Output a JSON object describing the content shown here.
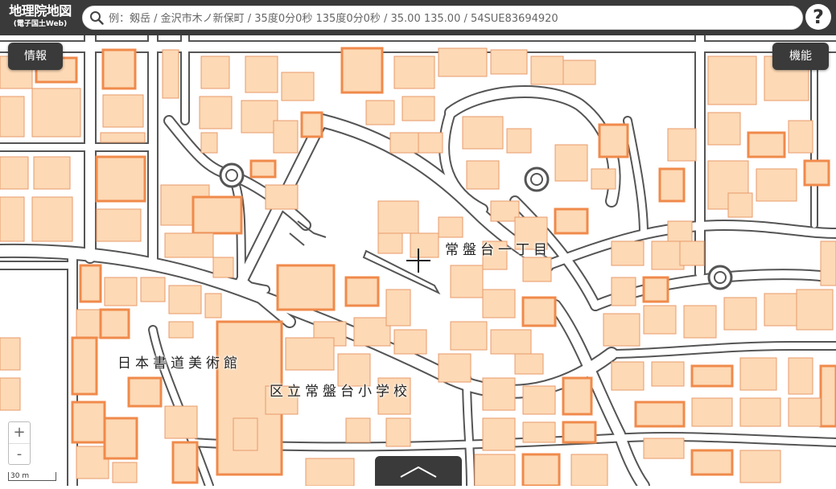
{
  "header": {
    "logo_main": "地理院地図",
    "logo_sub": "(電子国土Web)",
    "search_placeholder": "例：剱岳 / 金沢市木ノ新保町 / 35度0分0秒 135度0分0秒 / 35.00 135.00 / 54SUE83694920",
    "help_label": "?"
  },
  "buttons": {
    "info": "情報",
    "functions": "機能"
  },
  "map": {
    "labels": [
      {
        "id": "lbl-1",
        "text": "常盤台一丁目"
      },
      {
        "id": "lbl-2",
        "text": "日本書道美術館"
      },
      {
        "id": "lbl-3",
        "text": "区立常盤台小学校"
      }
    ],
    "colors": {
      "background": "#ffffff",
      "block": "#ffffff",
      "road_edge": "#555555",
      "building_fill": "#fdd9b5",
      "building_edge": "#e89a6a",
      "building_bold": "#f08a4b"
    }
  },
  "controls": {
    "zoom_in": "+",
    "zoom_out": "-",
    "scale": "30 m"
  },
  "icons": {
    "search": "search-icon",
    "help": "help-icon",
    "crosshair": "crosshair-icon",
    "expand": "chevron-up-icon"
  }
}
